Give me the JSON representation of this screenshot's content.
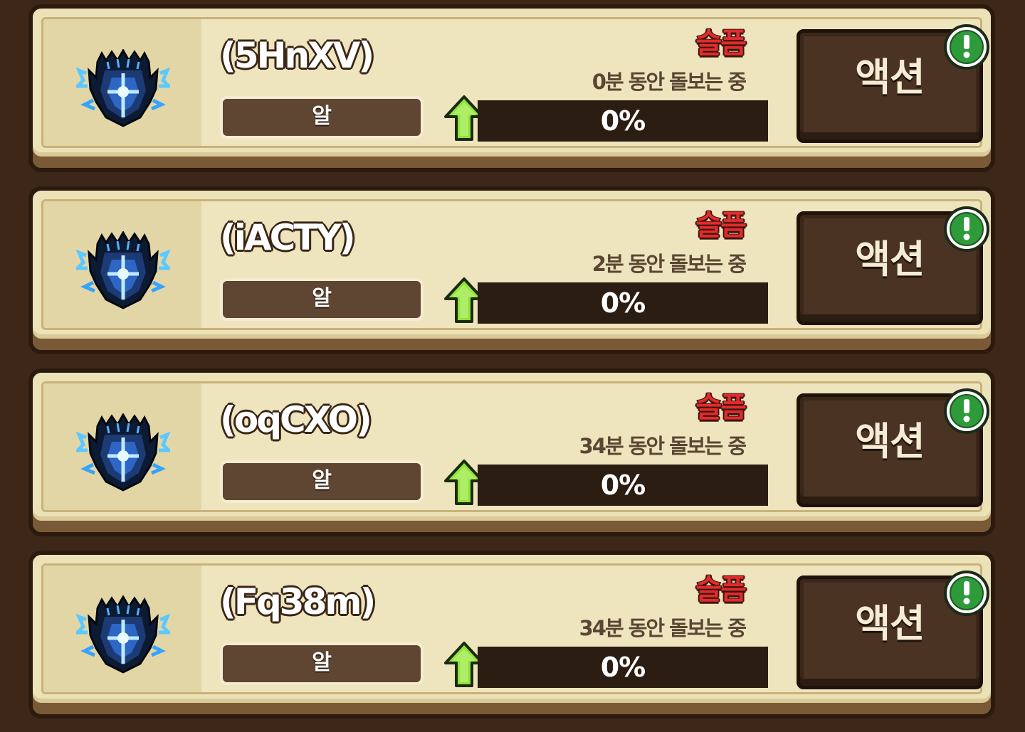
{
  "pets": [
    {
      "name": "(5HnXV)",
      "type": "알",
      "mood": "슬픔",
      "care_time": "0분 동안 돌보는 중",
      "progress_text": "0%",
      "progress_fraction": 0,
      "action_label": "액션",
      "pet_icon": "blue-dragon-egg-icon",
      "alert_icon": "exclamation-icon"
    },
    {
      "name": "(iACTY)",
      "type": "알",
      "mood": "슬픔",
      "care_time": "2분 동안 돌보는 중",
      "progress_text": "0%",
      "progress_fraction": 0,
      "action_label": "액션",
      "pet_icon": "blue-dragon-egg-icon",
      "alert_icon": "exclamation-icon"
    },
    {
      "name": "(oqCXO)",
      "type": "알",
      "mood": "슬픔",
      "care_time": "34분 동안 돌보는 중",
      "progress_text": "0%",
      "progress_fraction": 0,
      "action_label": "액션",
      "pet_icon": "blue-dragon-egg-icon",
      "alert_icon": "exclamation-icon"
    },
    {
      "name": "(Fq38m)",
      "type": "알",
      "mood": "슬픔",
      "care_time": "34분 동안 돌보는 중",
      "progress_text": "0%",
      "progress_fraction": 0,
      "action_label": "액션",
      "pet_icon": "blue-dragon-egg-icon",
      "alert_icon": "exclamation-icon"
    }
  ],
  "colors": {
    "background": "#3d2718",
    "card": "#ece2b8",
    "mood_sad": "#e32b2b",
    "progress_track": "#2c1d13",
    "progress_fill": "#7fd24a",
    "arrow_green": "#8fe33a",
    "alert_green": "#2f9a3a",
    "action_button": "#4a3322"
  }
}
